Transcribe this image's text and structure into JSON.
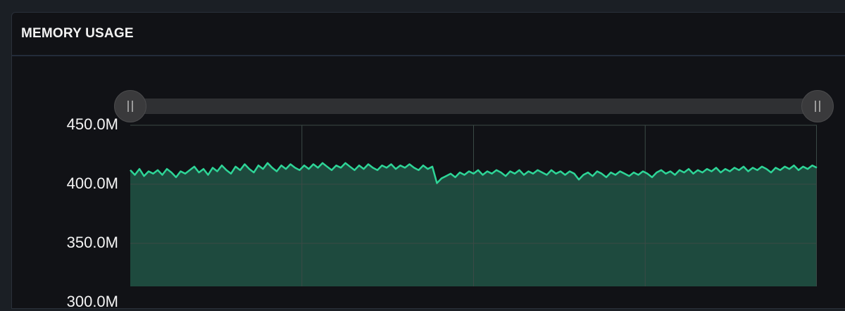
{
  "panel": {
    "title": "MEMORY USAGE"
  },
  "range_slider": {
    "start": 0,
    "end": 1
  },
  "colors": {
    "line": "#2ed597",
    "fill": "#1e4a3e",
    "grid": "#3b4a46",
    "background": "#111216"
  },
  "chart_data": {
    "type": "area",
    "title": "MEMORY USAGE",
    "xlabel": "",
    "ylabel": "",
    "ylim": [
      282,
      450
    ],
    "y_ticks": [
      {
        "value": 450,
        "label": "450.0M"
      },
      {
        "value": 400,
        "label": "400.0M"
      },
      {
        "value": 350,
        "label": "350.0M"
      },
      {
        "value": 300,
        "label": "300.0M"
      }
    ],
    "x_gridlines": 4,
    "grid": true,
    "legend": "none",
    "series": [
      {
        "unit": "MB",
        "values": [
          412,
          408,
          413,
          407,
          411,
          409,
          412,
          408,
          413,
          410,
          406,
          411,
          409,
          412,
          415,
          410,
          413,
          408,
          414,
          411,
          416,
          412,
          409,
          415,
          412,
          417,
          413,
          410,
          416,
          413,
          418,
          414,
          411,
          416,
          413,
          417,
          414,
          412,
          416,
          413,
          417,
          414,
          418,
          415,
          412,
          416,
          414,
          418,
          415,
          412,
          416,
          413,
          417,
          414,
          412,
          416,
          414,
          417,
          413,
          416,
          414,
          417,
          414,
          412,
          416,
          413,
          415,
          401,
          405,
          407,
          409,
          406,
          410,
          408,
          411,
          409,
          412,
          408,
          411,
          409,
          412,
          410,
          407,
          411,
          409,
          412,
          408,
          411,
          409,
          412,
          410,
          408,
          412,
          409,
          411,
          408,
          411,
          409,
          404,
          408,
          410,
          407,
          411,
          409,
          406,
          410,
          408,
          411,
          409,
          407,
          410,
          408,
          411,
          409,
          406,
          410,
          412,
          409,
          411,
          408,
          412,
          410,
          413,
          409,
          412,
          410,
          413,
          411,
          414,
          410,
          413,
          411,
          414,
          412,
          415,
          411,
          414,
          412,
          415,
          413,
          410,
          414,
          412,
          415,
          413,
          416,
          412,
          415,
          413,
          416,
          414
        ]
      }
    ]
  }
}
